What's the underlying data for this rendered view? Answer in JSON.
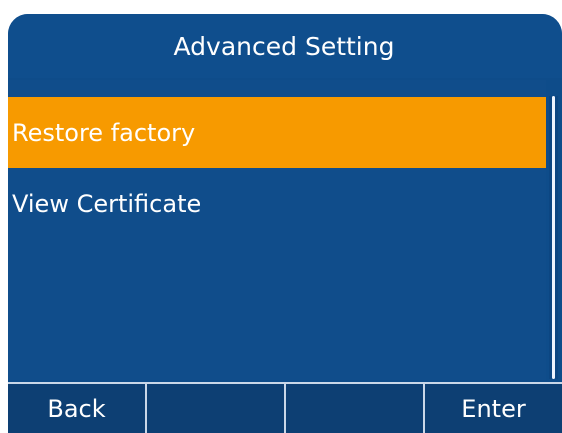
{
  "screen": {
    "title": "Advanced Setting"
  },
  "menu": {
    "items": [
      {
        "label": "Restore factory",
        "selected": true
      },
      {
        "label": "View Certificate",
        "selected": false
      }
    ]
  },
  "softkeys": {
    "key1": "Back",
    "key2": "",
    "key3": "",
    "key4": "Enter"
  },
  "colors": {
    "panel_blue": "#0e4c8a",
    "highlight_orange": "#f79a00",
    "text_white": "#ffffff"
  }
}
